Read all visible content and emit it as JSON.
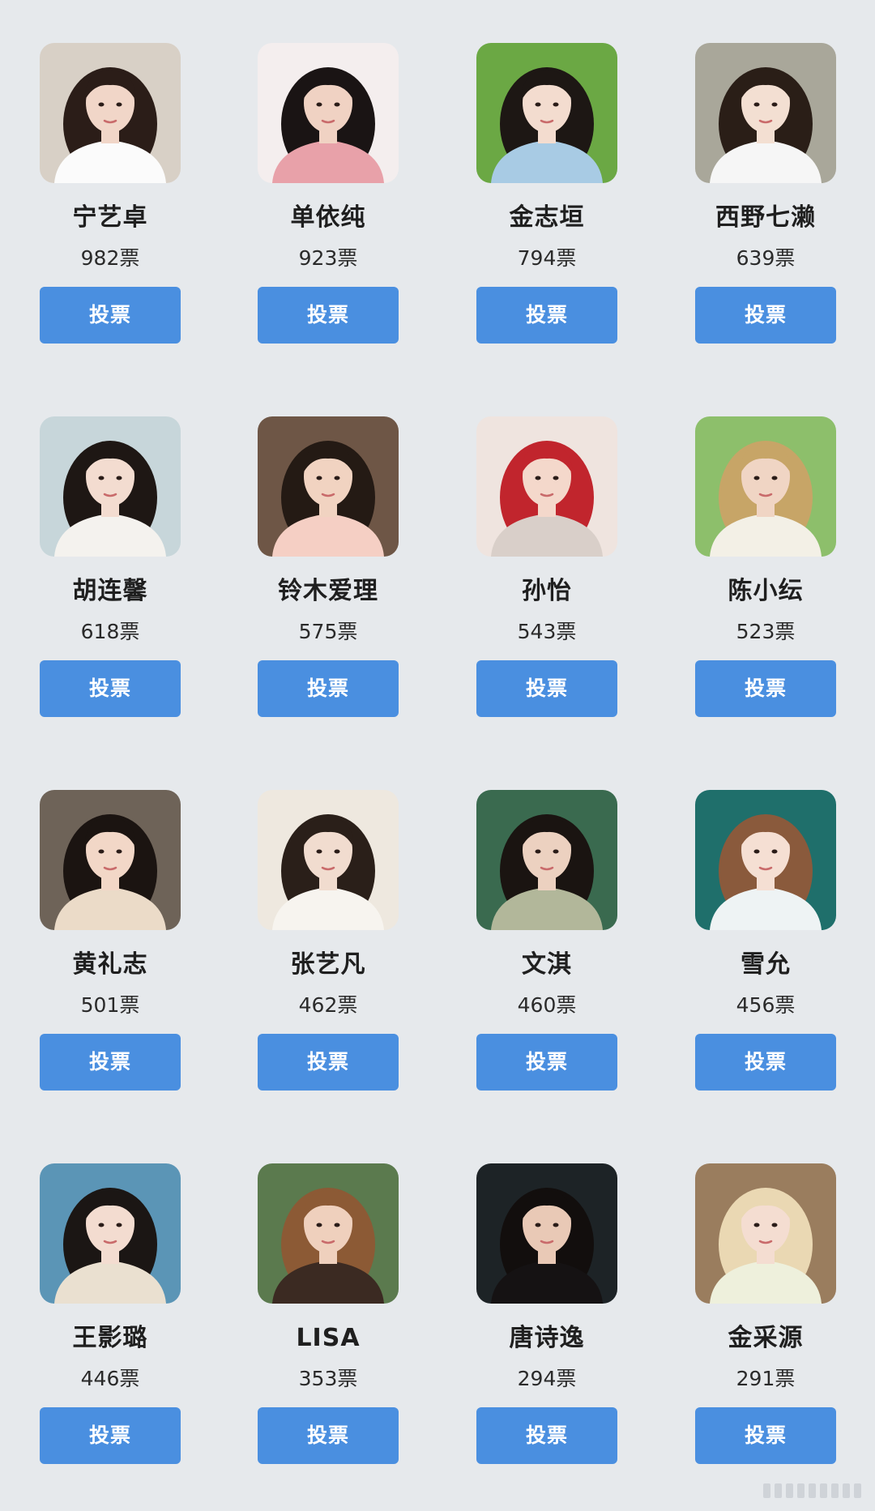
{
  "colors": {
    "background": "#e6e9ec",
    "button": "#4a8fe0",
    "button_text": "#ffffff",
    "name_text": "#1f1f1f"
  },
  "candidates": [
    {
      "name": "宁艺卓",
      "votes": "982票",
      "button": "投票",
      "photo": {
        "bg": "#d8d0c6",
        "skin": "#f1d6c8",
        "hair": "#2b1d18",
        "outfit": "#fbfbfb"
      }
    },
    {
      "name": "单依纯",
      "votes": "923票",
      "button": "投票",
      "photo": {
        "bg": "#f4eeee",
        "skin": "#f0d2c3",
        "hair": "#1a1414",
        "outfit": "#e8a1a9"
      }
    },
    {
      "name": "金志垣",
      "votes": "794票",
      "button": "投票",
      "photo": {
        "bg": "#6ba844",
        "skin": "#f3dccf",
        "hair": "#1d1714",
        "outfit": "#a8cbe4"
      }
    },
    {
      "name": "西野七濑",
      "votes": "639票",
      "button": "投票",
      "photo": {
        "bg": "#a9a79a",
        "skin": "#f3dfd2",
        "hair": "#2a1e17",
        "outfit": "#f6f6f6"
      }
    },
    {
      "name": "胡连馨",
      "votes": "618票",
      "button": "投票",
      "photo": {
        "bg": "#c7d6da",
        "skin": "#f3dcd0",
        "hair": "#1e1714",
        "outfit": "#f4f2ee"
      }
    },
    {
      "name": "铃木爱理",
      "votes": "575票",
      "button": "投票",
      "photo": {
        "bg": "#6e5646",
        "skin": "#f1d3c1",
        "hair": "#241a14",
        "outfit": "#f5cfc4"
      }
    },
    {
      "name": "孙怡",
      "votes": "543票",
      "button": "投票",
      "photo": {
        "bg": "#efe4df",
        "skin": "#f4d8cb",
        "hair": "#c1252d",
        "outfit": "#d9cfc9"
      }
    },
    {
      "name": "陈小纭",
      "votes": "523票",
      "button": "投票",
      "photo": {
        "bg": "#8dbf6b",
        "skin": "#f0d5c4",
        "hair": "#c7a567",
        "outfit": "#f3f0e6"
      }
    },
    {
      "name": "黄礼志",
      "votes": "501票",
      "button": "投票",
      "photo": {
        "bg": "#6e6358",
        "skin": "#f2d7c7",
        "hair": "#1b1411",
        "outfit": "#ebdbc8"
      }
    },
    {
      "name": "张艺凡",
      "votes": "462票",
      "button": "投票",
      "photo": {
        "bg": "#eee8df",
        "skin": "#f1dccf",
        "hair": "#2a1f19",
        "outfit": "#f7f4ef"
      }
    },
    {
      "name": "文淇",
      "votes": "460票",
      "button": "投票",
      "photo": {
        "bg": "#3a6a4f",
        "skin": "#ecd1c0",
        "hair": "#1a1411",
        "outfit": "#b2b79a"
      }
    },
    {
      "name": "雪允",
      "votes": "456票",
      "button": "投票",
      "photo": {
        "bg": "#1f6f6b",
        "skin": "#f5dfd3",
        "hair": "#8a5a3c",
        "outfit": "#eef3f4"
      }
    },
    {
      "name": "王影璐",
      "votes": "446票",
      "button": "投票",
      "photo": {
        "bg": "#5b95b6",
        "skin": "#f3dcd0",
        "hair": "#1b1614",
        "outfit": "#eae0d0"
      }
    },
    {
      "name": "LISA",
      "votes": "353票",
      "button": "投票",
      "photo": {
        "bg": "#5b7a4e",
        "skin": "#efd0bd",
        "hair": "#8c5a35",
        "outfit": "#3b2a22"
      }
    },
    {
      "name": "唐诗逸",
      "votes": "294票",
      "button": "投票",
      "photo": {
        "bg": "#1d2326",
        "skin": "#e9c9b6",
        "hair": "#120e0d",
        "outfit": "#151213"
      }
    },
    {
      "name": "金采源",
      "votes": "291票",
      "button": "投票",
      "photo": {
        "bg": "#9a7d5e",
        "skin": "#f4ddd1",
        "hair": "#ead8b3",
        "outfit": "#eef0dc"
      }
    }
  ]
}
